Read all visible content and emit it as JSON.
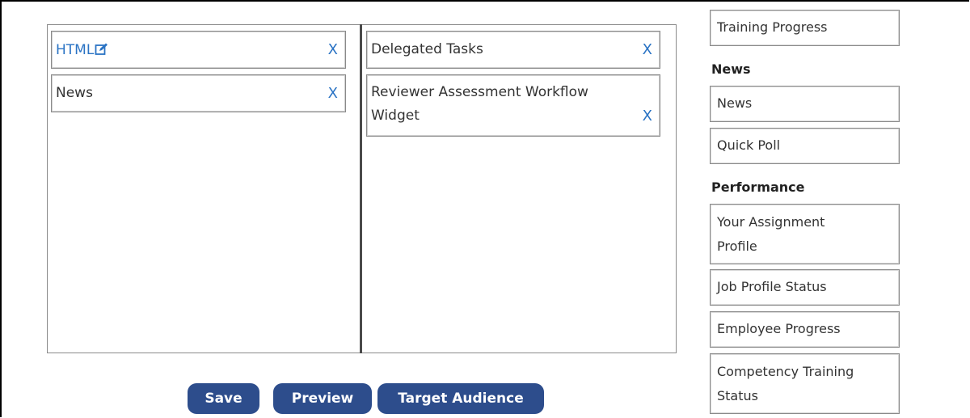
{
  "layout": {
    "left_column": {
      "widgets": [
        {
          "label": "HTML",
          "remove": "X"
        },
        {
          "label": "News",
          "remove": "X"
        }
      ]
    },
    "right_column": {
      "widgets": [
        {
          "label": "Delegated Tasks",
          "remove": "X"
        },
        {
          "label_line1": "Reviewer Assessment Workflow",
          "label_line2": "Widget",
          "remove": "X"
        }
      ]
    }
  },
  "buttons": {
    "save": "Save",
    "preview": "Preview",
    "target_audience": "Target Audience"
  },
  "sidebar": {
    "top_item": "Training Progress",
    "groups": [
      {
        "heading": "News",
        "items": [
          "News",
          "Quick Poll"
        ]
      },
      {
        "heading": "Performance",
        "items": [
          "Your Assignment Profile",
          "Job Profile Status",
          "Employee Progress",
          "Competency Training Status"
        ]
      }
    ],
    "wrapped": {
      "assignment_line1": "Your Assignment",
      "assignment_line2": "Profile",
      "competency_line1": "Competency Training",
      "competency_line2": "Status"
    }
  },
  "colors": {
    "link": "#2a73c4",
    "button_bg": "#2d4d8c",
    "button_text": "#ffffff"
  },
  "icons": {
    "edit": "edit-icon",
    "remove": "x-remove-icon"
  }
}
